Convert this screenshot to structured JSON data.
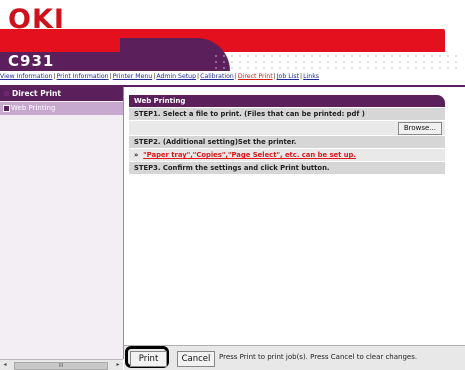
{
  "brand": {
    "logo": "OKI",
    "model": "C931",
    "red": "#e4101e",
    "purple": "#5b1f5c"
  },
  "nav": {
    "items": [
      "View Information",
      "Print Information",
      "Printer Menu",
      "Admin Setup",
      "Calibration",
      "Direct Print",
      "Job List",
      "Links"
    ],
    "active": "Direct Print",
    "separator": "|"
  },
  "sidebar": {
    "header": "Direct Print",
    "items": [
      {
        "label": "Web Printing",
        "selected": true
      }
    ]
  },
  "main": {
    "title": "Web Printing",
    "step1": "STEP1. Select a file to print. (Files that can be printed: pdf )",
    "browse_label": "Browse...",
    "step2": "STEP2. (Additional setting)Set the printer.",
    "step2_bullet": "»",
    "step2_link": "\"Paper tray\",\"Copies\",\"Page Select\", etc. can be set up.",
    "step3": "STEP3. Confirm the settings and click Print button."
  },
  "footer": {
    "print_label": "Print",
    "cancel_label": "Cancel",
    "hint": "Press Print to print job(s). Press Cancel to clear changes."
  },
  "scrollbar": {
    "left_arrow": "◂",
    "right_arrow": "▸",
    "grip": "III"
  }
}
